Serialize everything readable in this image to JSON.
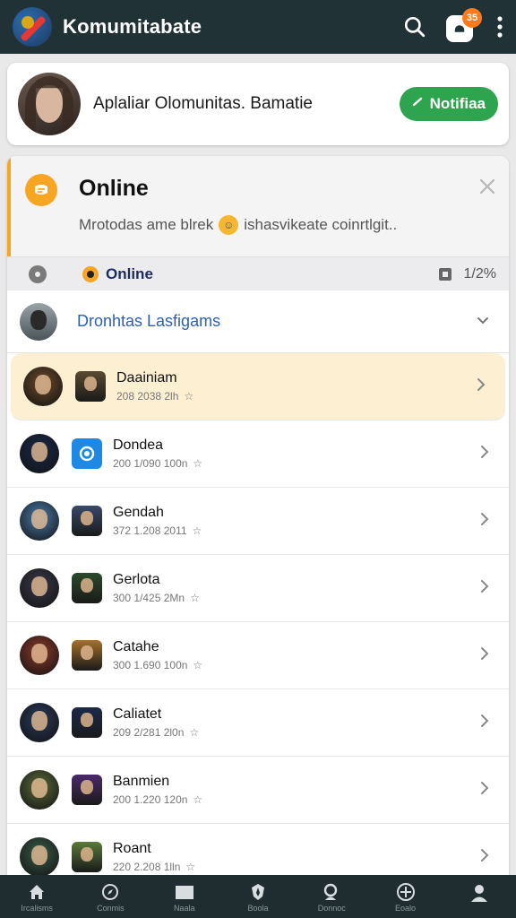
{
  "app": {
    "title": "Komumitabate",
    "notification_count": "35"
  },
  "profile": {
    "text": "Aplaliar Olomunitas. Bamatie",
    "button_label": "Notifiaa"
  },
  "online": {
    "title": "Online",
    "subtitle_left": "Mrotodas ame blrek",
    "subtitle_right": "ishasvikeate coinrtlgit.."
  },
  "strip": {
    "label": "Online",
    "right_value": "1/2%"
  },
  "group": {
    "label": "Dronhtas Lasfigams"
  },
  "games": [
    {
      "name": "Daainiam",
      "meta": "208 2038 2lh",
      "avatar_color": "#6b4a2a",
      "thumb_color": "#5a4a30"
    },
    {
      "name": "Dondea",
      "meta": "200 1/090 100n",
      "avatar_color": "#1a2a4a",
      "thumb_color": "#1e88e5"
    },
    {
      "name": "Gendah",
      "meta": "372 1.208 2011",
      "avatar_color": "#4a7aa8",
      "thumb_color": "#3a4a6a"
    },
    {
      "name": "Gerlota",
      "meta": "300 1/425 2Mn",
      "avatar_color": "#3a3a4a",
      "thumb_color": "#2a4a2a"
    },
    {
      "name": "Catahe",
      "meta": "300 1.690 100n",
      "avatar_color": "#8a3a2a",
      "thumb_color": "#a8702a"
    },
    {
      "name": "Caliatet",
      "meta": "209 2/281 2l0n",
      "avatar_color": "#2a3a5a",
      "thumb_color": "#1a2a4a"
    },
    {
      "name": "Banmien",
      "meta": "200 1.220 120n",
      "avatar_color": "#5a6a3a",
      "thumb_color": "#4a2a6a"
    },
    {
      "name": "Roant",
      "meta": "220 2.208 1lln",
      "avatar_color": "#3a5a4a",
      "thumb_color": "#5a7a3a"
    }
  ],
  "nav": [
    {
      "label": "Ircalisms",
      "icon": "home-icon"
    },
    {
      "label": "Conmis",
      "icon": "compass-icon"
    },
    {
      "label": "Naala",
      "icon": "folder-icon"
    },
    {
      "label": "Boola",
      "icon": "shield-icon"
    },
    {
      "label": "Donnoc",
      "icon": "search-person-icon"
    },
    {
      "label": "Eoalo",
      "icon": "add-circle-icon"
    },
    {
      "label": "",
      "icon": "profile-icon"
    }
  ],
  "colors": {
    "topbar": "#213236",
    "accent": "#f6a623",
    "notify_green": "#2ea44f",
    "link_blue": "#2b5fb0"
  }
}
